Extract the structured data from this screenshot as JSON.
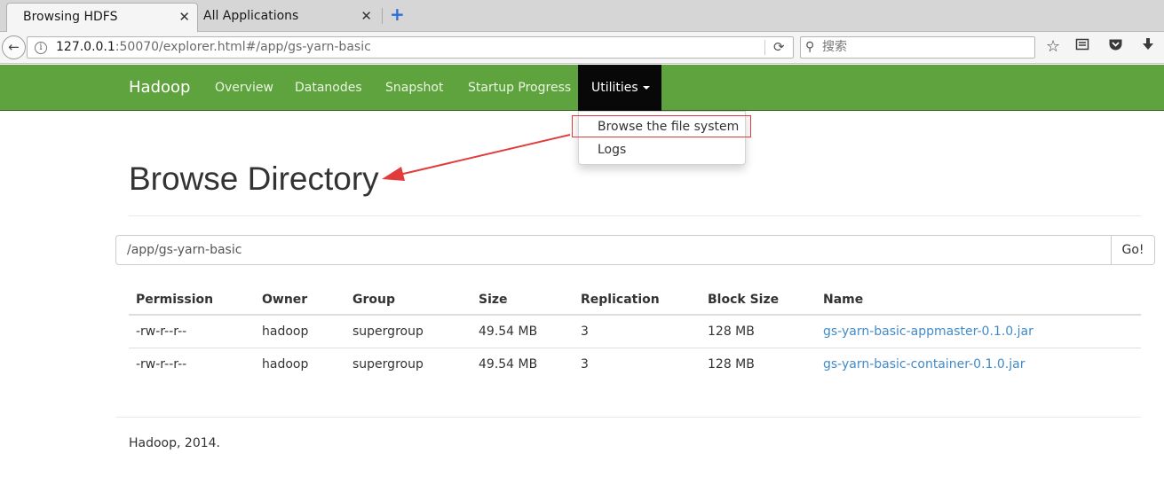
{
  "browser": {
    "tabs": [
      {
        "title": "Browsing HDFS",
        "close": "✕"
      },
      {
        "title": "All Applications",
        "close": "✕"
      }
    ],
    "new_tab": "+",
    "back_icon": "←",
    "url_host": "127.0.0.1",
    "url_rest": ":50070/explorer.html#/app/gs-yarn-basic",
    "search_placeholder": "搜索",
    "icons": [
      "info-icon",
      "reload-icon",
      "search-icon",
      "bookmark-star-icon",
      "reading-list-icon",
      "pocket-icon",
      "download-icon"
    ]
  },
  "nav": {
    "brand": "Hadoop",
    "links": [
      "Overview",
      "Datanodes",
      "Snapshot",
      "Startup Progress"
    ],
    "utilities": "Utilities"
  },
  "dropdown": {
    "items": [
      "Browse the file system",
      "Logs"
    ]
  },
  "page": {
    "title": "Browse Directory",
    "path": "/app/gs-yarn-basic",
    "go": "Go!"
  },
  "table": {
    "headers": [
      "Permission",
      "Owner",
      "Group",
      "Size",
      "Replication",
      "Block Size",
      "Name"
    ],
    "rows": [
      [
        "-rw-r--r--",
        "hadoop",
        "supergroup",
        "49.54 MB",
        "3",
        "128 MB",
        "gs-yarn-basic-appmaster-0.1.0.jar"
      ],
      [
        "-rw-r--r--",
        "hadoop",
        "supergroup",
        "49.54 MB",
        "3",
        "128 MB",
        "gs-yarn-basic-container-0.1.0.jar"
      ]
    ]
  },
  "footer": "Hadoop, 2014.",
  "colors": {
    "navbar_green": "#5fa33e",
    "active_nav": "#080808",
    "link_blue": "#428bca",
    "annotation_red": "#e23b3b"
  }
}
